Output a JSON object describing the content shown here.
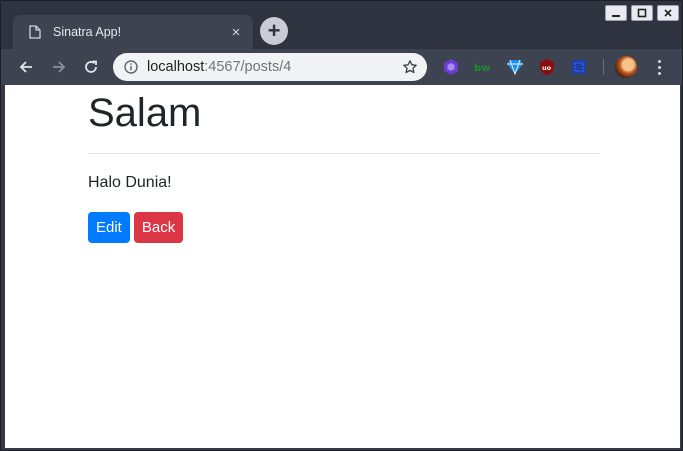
{
  "browser": {
    "tab": {
      "title": "Sinatra App!",
      "favicon": "page-icon",
      "close_glyph": "×"
    },
    "newtab_glyph": "+",
    "url": {
      "host": "localhost",
      "path": ":4567/posts/4"
    },
    "extensions": [
      "purple-shield-extension-icon",
      "green-text-extension-icon",
      "diamond-extension-icon",
      "ublock-extension-icon",
      "blue-square-extension-icon"
    ]
  },
  "page": {
    "title": "Salam",
    "body": "Halo Dunia!",
    "actions": {
      "edit_label": "Edit",
      "back_label": "Back"
    }
  },
  "colors": {
    "primary": "#007bff",
    "danger": "#dc3545",
    "chrome_dark": "#2f3340"
  }
}
